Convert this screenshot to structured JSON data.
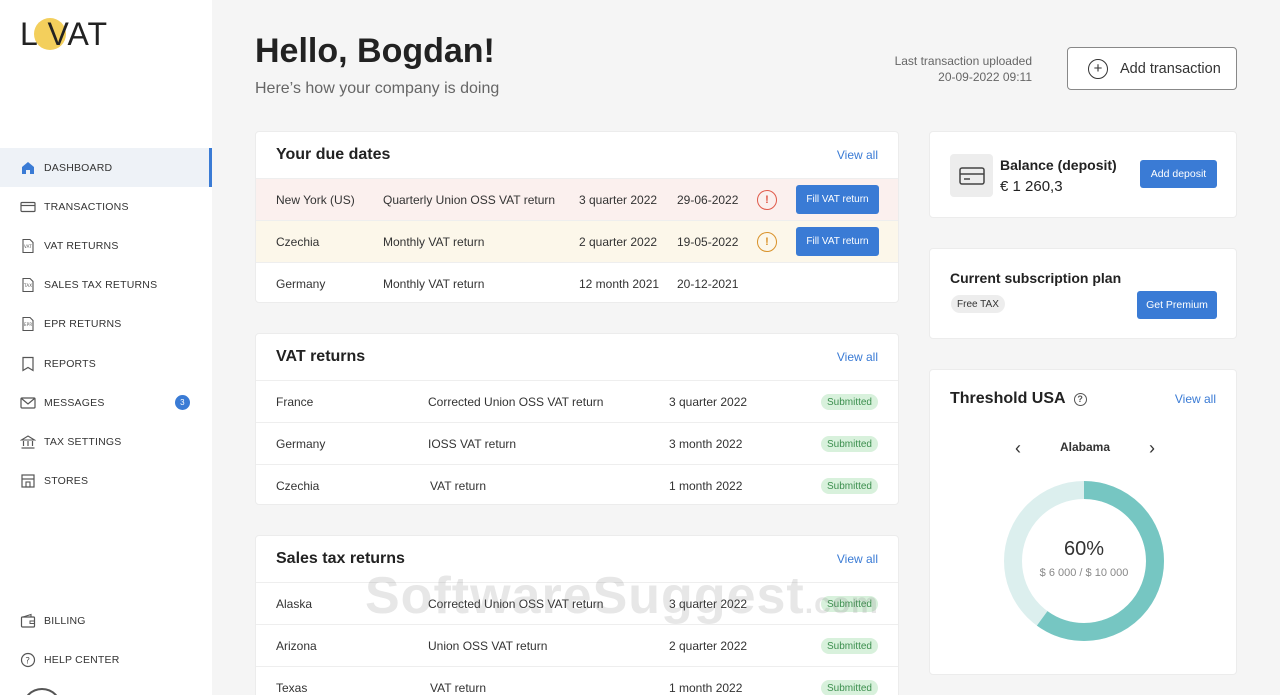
{
  "app": {
    "logo_text": "L VAT"
  },
  "sidebar": {
    "items": [
      {
        "label": "DASHBOARD",
        "icon": "home-icon",
        "active": true
      },
      {
        "label": "TRANSACTIONS",
        "icon": "card-icon"
      },
      {
        "label": "VAT RETURNS",
        "icon": "vat-doc-icon"
      },
      {
        "label": "SALES TAX RETURNS",
        "icon": "tax-doc-icon"
      },
      {
        "label": "EPR RETURNS",
        "icon": "epr-doc-icon"
      },
      {
        "label": "REPORTS",
        "icon": "report-icon"
      },
      {
        "label": "MESSAGES",
        "icon": "mail-icon",
        "badge": "3"
      },
      {
        "label": "TAX SETTINGS",
        "icon": "bank-icon"
      },
      {
        "label": "STORES",
        "icon": "store-icon"
      }
    ],
    "bottom": [
      {
        "label": "BILLING",
        "icon": "wallet-icon"
      },
      {
        "label": "HELP CENTER",
        "icon": "help-icon"
      }
    ]
  },
  "header": {
    "greeting": "Hello, Bogdan!",
    "subtitle": "Here’s how your company is doing",
    "last_tx_label": "Last transaction uploaded",
    "last_tx_time": "20-09-2022 09:11",
    "add_tx_label": "Add transaction"
  },
  "due_dates": {
    "title": "Your due dates",
    "view_all": "View all",
    "rows": [
      {
        "country": "New York (US)",
        "type": "Quarterly Union OSS VAT return",
        "period": "3 quarter 2022",
        "date": "29-06-2022",
        "status": "overdue",
        "action": "Fill VAT return",
        "warn": "!"
      },
      {
        "country": "Czechia",
        "type": "Monthly VAT return",
        "period": "2 quarter 2022",
        "date": "19-05-2022",
        "status": "warning",
        "action": "Fill VAT return",
        "warn": "!"
      },
      {
        "country": "Germany",
        "type": "Monthly VAT return",
        "period": "12 month 2021",
        "date": "20-12-2021",
        "status": "normal"
      }
    ]
  },
  "vat_returns": {
    "title": "VAT returns",
    "view_all": "View all",
    "rows": [
      {
        "country": "France",
        "type": "Corrected Union OSS VAT return",
        "period": "3 quarter 2022",
        "status": "Submitted"
      },
      {
        "country": "Germany",
        "type": "IOSS VAT return",
        "period": "3 month 2022",
        "status": "Submitted"
      },
      {
        "country": "Czechia",
        "type": "VAT return",
        "period": "1 month 2022",
        "status": "Submitted"
      }
    ]
  },
  "sales_tax_returns": {
    "title": "Sales tax returns",
    "view_all": "View all",
    "rows": [
      {
        "country": "Alaska",
        "type": "Corrected Union OSS VAT return",
        "period": "3 quarter 2022",
        "status": "Submitted"
      },
      {
        "country": "Arizona",
        "type": "Union OSS VAT return",
        "period": "2 quarter 2022",
        "status": "Submitted"
      },
      {
        "country": "Texas",
        "type": "VAT return",
        "period": "1 month 2022",
        "status": "Submitted"
      }
    ]
  },
  "balance": {
    "label": "Balance (deposit)",
    "value": "€ 1 260,3",
    "button": "Add deposit"
  },
  "subscription": {
    "title": "Current subscription plan",
    "plan": "Free TAX",
    "button": "Get Premium"
  },
  "threshold": {
    "title": "Threshold USA",
    "view_all": "View all",
    "state": "Alabama",
    "percent_label": "60%",
    "amount_label": "$ 6 000 / $ 10 000",
    "progress": 0.6,
    "colors": {
      "fill": "#76c6c2",
      "track": "#dcefee"
    }
  },
  "watermark": {
    "text": "SoftwareSuggest",
    "suffix": ".com"
  }
}
